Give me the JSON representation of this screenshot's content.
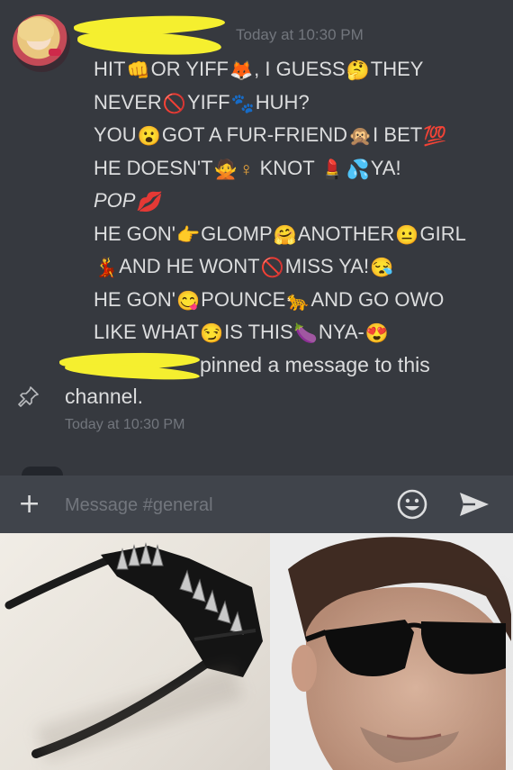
{
  "chat": {
    "timestamp_top": "Today at 10:30 PM",
    "message_lines": [
      [
        "HIT",
        "👊",
        "OR YIFF",
        "🦊",
        ", I GUESS",
        "🤔",
        "THEY"
      ],
      [
        "NEVER",
        "🚫",
        "YIFF",
        "🐾",
        "HUH?"
      ],
      [
        "YOU",
        "😮",
        "GOT",
        "  ",
        "A FUR-FRIEND",
        "🙊",
        "I BET",
        "💯"
      ],
      [
        "HE DOESN'T",
        "🙅",
        "♀",
        " KNOT ",
        "💄",
        "💦",
        "YA!"
      ],
      [
        "POP",
        "💋"
      ],
      [
        "HE GON'",
        "👉",
        "GLOMP",
        "🤗",
        "ANOTHER",
        "😐",
        "GIRL"
      ],
      [
        "💃",
        "AND HE WONT",
        "🚫",
        "MISS YA!",
        "😪"
      ],
      [
        "HE GON'",
        "😋",
        "POUNCE",
        "🐆",
        "AND GO OWO"
      ],
      [
        "LIKE WHAT",
        "😏",
        "IS THIS",
        "🍆",
        "NYA-",
        "😍"
      ]
    ],
    "pin_text": "pinned a message to this",
    "pin_channel": "channel.",
    "timestamp_bottom": "Today at 10:30 PM"
  },
  "composer": {
    "placeholder": "Message #general",
    "plus_label": "+"
  },
  "colors": {
    "chat_bg": "#36393f",
    "composer_bg": "#40444b",
    "text": "#dcddde",
    "muted": "#72767d",
    "scribble": "#f5ef2f"
  },
  "icons": {
    "add": "plus-icon",
    "emoji": "emoji-icon",
    "send": "send-icon",
    "pin": "pin-icon"
  }
}
